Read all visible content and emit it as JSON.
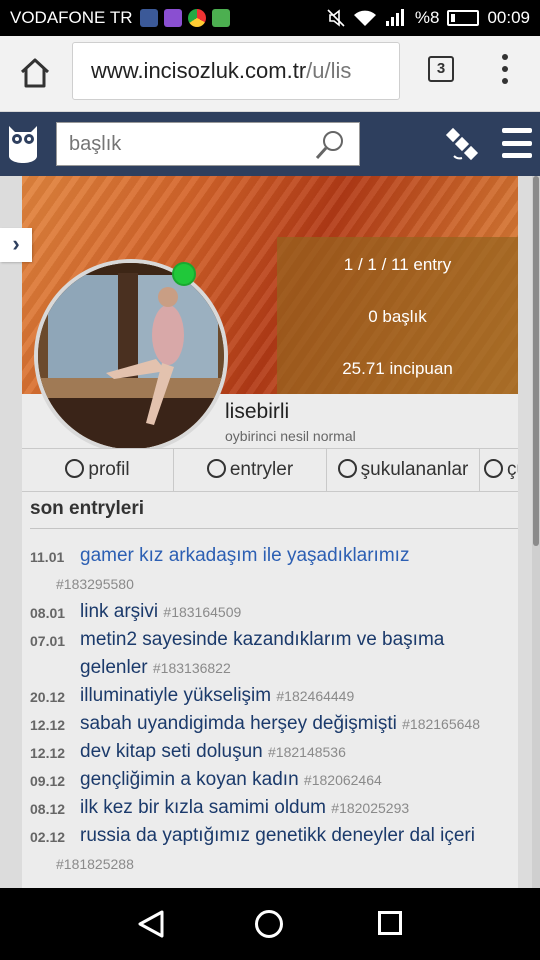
{
  "status_bar": {
    "carrier": "VODAFONE TR",
    "battery": "%8",
    "time": "00:09"
  },
  "browser": {
    "url_host": "www.incisozluk.com.tr",
    "url_path": "/u/lis",
    "tab_count": "3"
  },
  "site_header": {
    "search_placeholder": "başlık"
  },
  "profile": {
    "stats": {
      "entries": "1 / 1 / 11 entry",
      "topics": "0 başlık",
      "points": "25.71 incipuan"
    },
    "username": "lisebirli",
    "subtitle": "oybirinci nesil normal",
    "online": true
  },
  "tabs": [
    {
      "label": "profil",
      "icon": "cool-face-icon"
    },
    {
      "label": "entryler",
      "icon": "smile-face-icon"
    },
    {
      "label": "şukulananlar",
      "icon": "smile-face-icon"
    },
    {
      "label": "çükülenenler",
      "icon": "sad-face-icon"
    }
  ],
  "recent": {
    "title": "son entryleri",
    "items": [
      {
        "date": "11.01",
        "title": "gamer kız arkadaşım ile yaşadıklarımız",
        "id": "#183295580"
      },
      {
        "date": "08.01",
        "title": "link arşivi",
        "id": "#183164509"
      },
      {
        "date": "07.01",
        "title": "metin2 sayesinde kazandıklarım ve başıma gelenler",
        "id": "#183136822"
      },
      {
        "date": "20.12",
        "title": "illuminatiyle yükselişim",
        "id": "#182464449"
      },
      {
        "date": "12.12",
        "title": "sabah uyandigimda herşey değişmişti",
        "id": "#182165648"
      },
      {
        "date": "12.12",
        "title": "dev kitap seti doluşun",
        "id": "#182148536"
      },
      {
        "date": "09.12",
        "title": "gençliğimin a koyan kadın",
        "id": "#182062464"
      },
      {
        "date": "08.12",
        "title": "ilk kez bir kızla samimi oldum",
        "id": "#182025293"
      },
      {
        "date": "02.12",
        "title": "russia da yaptığımız genetikk deneyler dal içeri",
        "id": "#181825288"
      }
    ]
  }
}
